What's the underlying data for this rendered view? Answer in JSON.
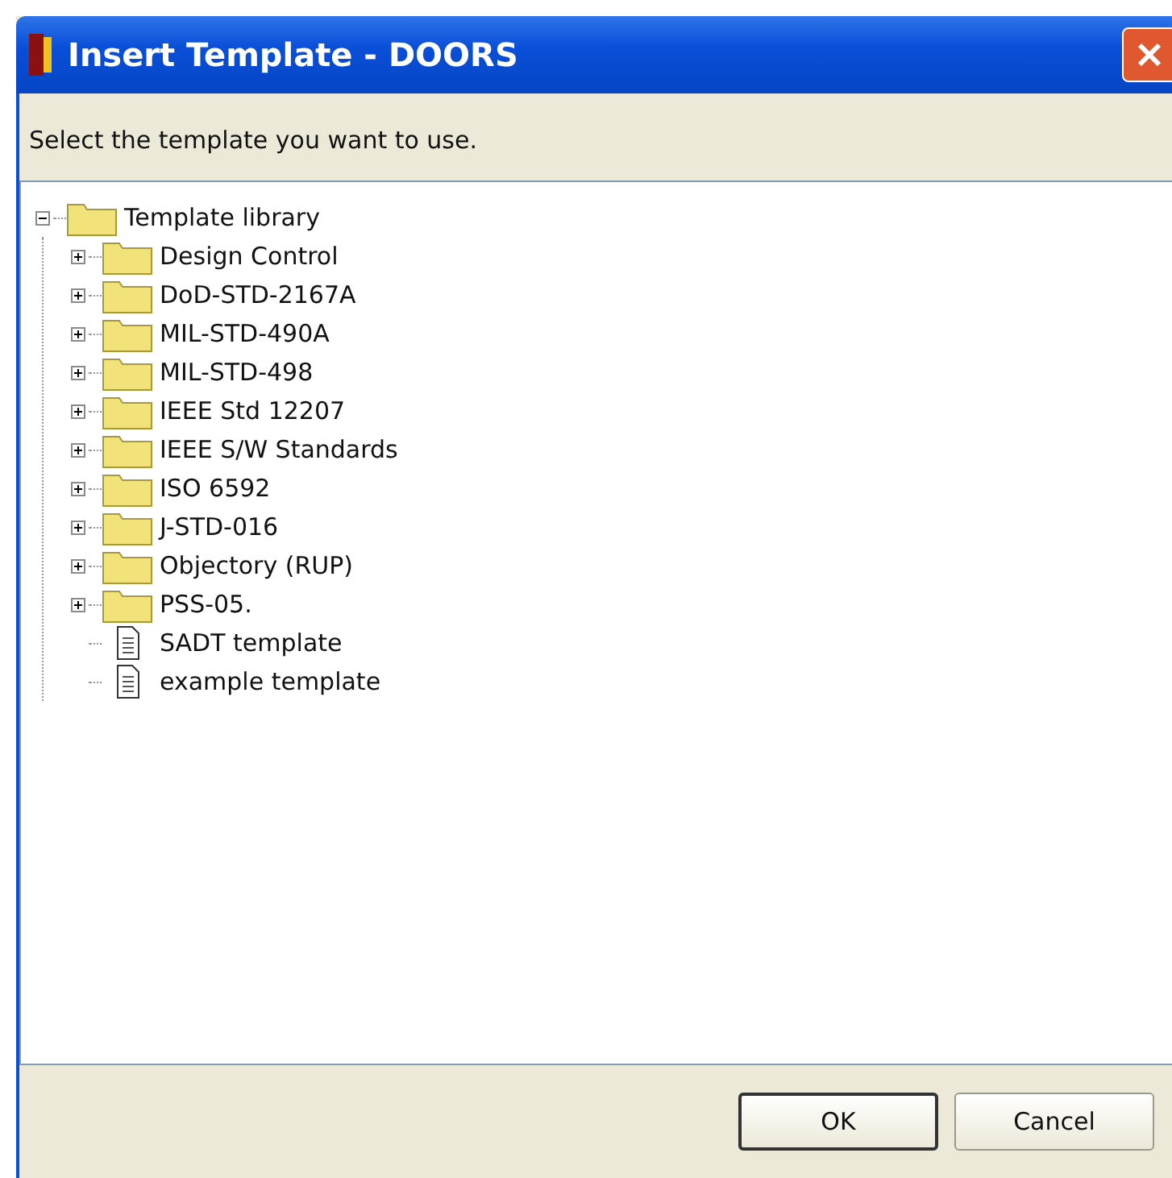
{
  "window": {
    "title": "Insert Template - DOORS"
  },
  "instruction": "Select the template you want to use.",
  "tree": {
    "label": "Template library",
    "kind": "folder",
    "expanded": true,
    "children": [
      {
        "label": "Design Control",
        "kind": "folder",
        "expanded": false
      },
      {
        "label": "DoD-STD-2167A",
        "kind": "folder",
        "expanded": false
      },
      {
        "label": "MIL-STD-490A",
        "kind": "folder",
        "expanded": false
      },
      {
        "label": "MIL-STD-498",
        "kind": "folder",
        "expanded": false
      },
      {
        "label": "IEEE Std 12207",
        "kind": "folder",
        "expanded": false
      },
      {
        "label": "IEEE S/W Standards",
        "kind": "folder",
        "expanded": false
      },
      {
        "label": "ISO 6592",
        "kind": "folder",
        "expanded": false
      },
      {
        "label": "J-STD-016",
        "kind": "folder",
        "expanded": false
      },
      {
        "label": "Objectory (RUP)",
        "kind": "folder",
        "expanded": false
      },
      {
        "label": "PSS-05.",
        "kind": "folder",
        "expanded": false
      },
      {
        "label": "SADT template",
        "kind": "file"
      },
      {
        "label": "example template",
        "kind": "file"
      }
    ]
  },
  "buttons": [
    {
      "label": "OK",
      "default": true
    },
    {
      "label": "Cancel",
      "default": false
    }
  ]
}
